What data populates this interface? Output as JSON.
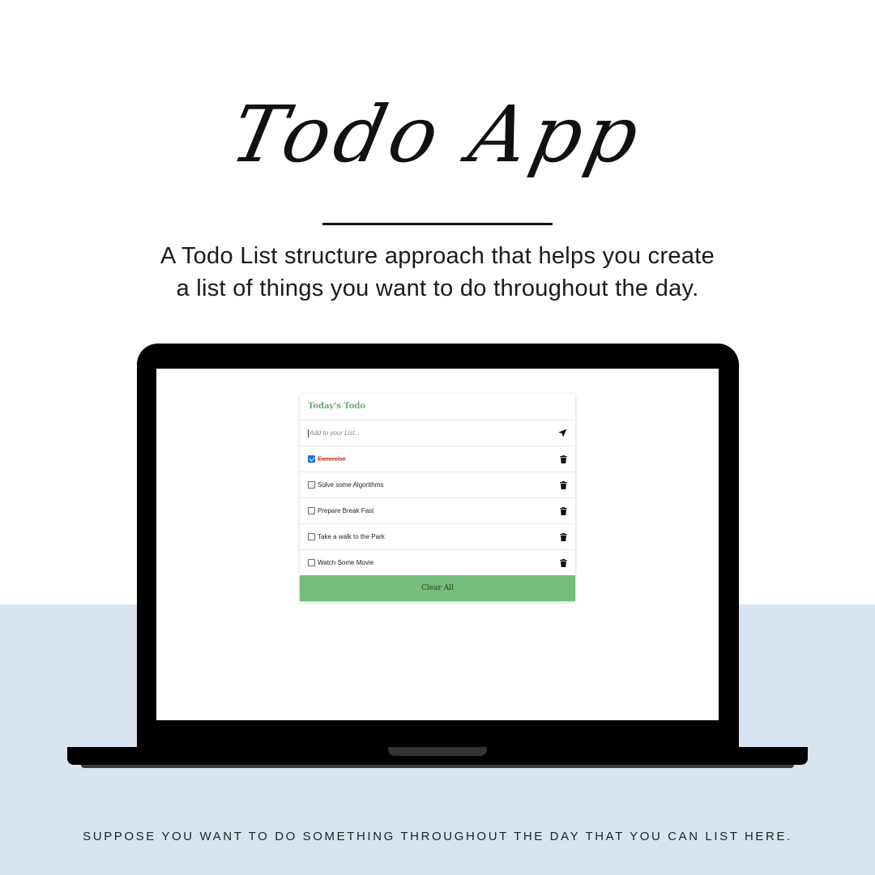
{
  "promo": {
    "title": "Todo App",
    "subtitle_line1": "A Todo List structure approach that helps you create",
    "subtitle_line2": "a list of things you want to do throughout the day.",
    "footer": "SUPPOSE YOU WANT TO DO SOMETHING THROUGHOUT THE DAY THAT YOU CAN LIST HERE."
  },
  "app": {
    "header": "Today's Todo",
    "input": {
      "placeholder": "Add to your List...",
      "value": ""
    },
    "send_icon": "send-icon",
    "items": [
      {
        "label": "Excercise",
        "checked": true
      },
      {
        "label": "Solve some Algorithms",
        "checked": false
      },
      {
        "label": "Prepare Break Fast",
        "checked": false
      },
      {
        "label": "Take a walk to the Park",
        "checked": false
      },
      {
        "label": "Watch Some Movie",
        "checked": false
      }
    ],
    "delete_icon": "trash-icon",
    "clear_label": "Clear All"
  },
  "colors": {
    "header_green": "#6aa96e",
    "button_green": "#74be7a",
    "band_blue": "#d8e5f0",
    "done_red": "#c0392b"
  }
}
